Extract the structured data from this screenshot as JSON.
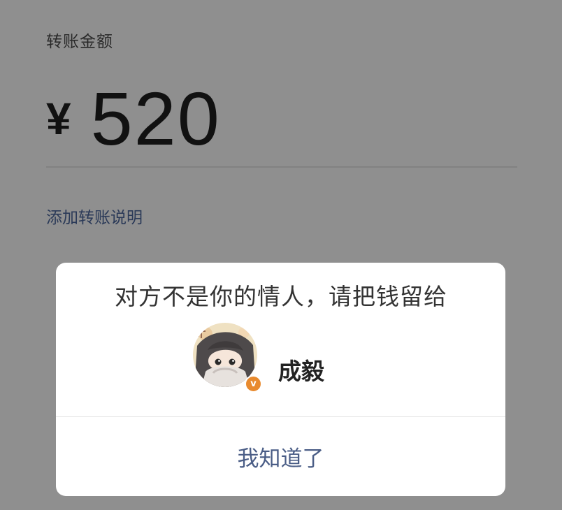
{
  "transfer": {
    "amount_label": "转账金额",
    "currency_symbol": "¥",
    "amount": "520",
    "add_note_label": "添加转账说明"
  },
  "dialog": {
    "message": "对方不是你的情人，请把钱留给",
    "recipient_name": "成毅",
    "confirm_label": "我知道了"
  },
  "avatar": {
    "badge_symbol": "v",
    "badge_color": "#e88a2e"
  },
  "colors": {
    "dim_background": "#8f8f8f",
    "dialog_background": "#ffffff",
    "link_text": "#2b3a58",
    "button_text": "#4a5d86"
  }
}
